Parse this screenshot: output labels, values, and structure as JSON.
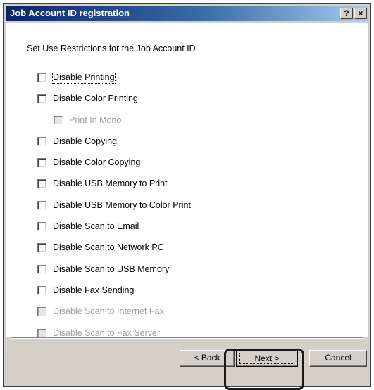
{
  "window": {
    "title": "Job Account ID registration",
    "help_button": "?",
    "close_button": "×"
  },
  "content": {
    "heading": "Set Use Restrictions for the Job Account ID",
    "options": [
      {
        "label": "Disable Printing",
        "checked": false,
        "enabled": true
      },
      {
        "label": "Disable Color Printing",
        "checked": false,
        "enabled": true
      },
      {
        "label": "Print In Mono",
        "checked": false,
        "enabled": false
      },
      {
        "label": "Disable Copying",
        "checked": false,
        "enabled": true
      },
      {
        "label": "Disable Color Copying",
        "checked": false,
        "enabled": true
      },
      {
        "label": "Disable USB Memory to Print",
        "checked": false,
        "enabled": true
      },
      {
        "label": "Disable USB Memory to Color Print",
        "checked": false,
        "enabled": true
      },
      {
        "label": "Disable Scan to Email",
        "checked": false,
        "enabled": true
      },
      {
        "label": "Disable Scan to Network PC",
        "checked": false,
        "enabled": true
      },
      {
        "label": "Disable Scan to USB Memory",
        "checked": false,
        "enabled": true
      },
      {
        "label": "Disable Fax Sending",
        "checked": false,
        "enabled": true
      },
      {
        "label": "Disable Scan to Internet Fax",
        "checked": false,
        "enabled": false
      },
      {
        "label": "Disable Scan to Fax Server",
        "checked": false,
        "enabled": false
      }
    ]
  },
  "footer": {
    "back_label": "< Back",
    "next_label": "Next >",
    "cancel_label": "Cancel"
  },
  "colors": {
    "titlebar_start": "#0a246a",
    "titlebar_end": "#a6caf0",
    "dialog_face": "#d4d0c8",
    "disabled_text": "#a0a0a0"
  }
}
